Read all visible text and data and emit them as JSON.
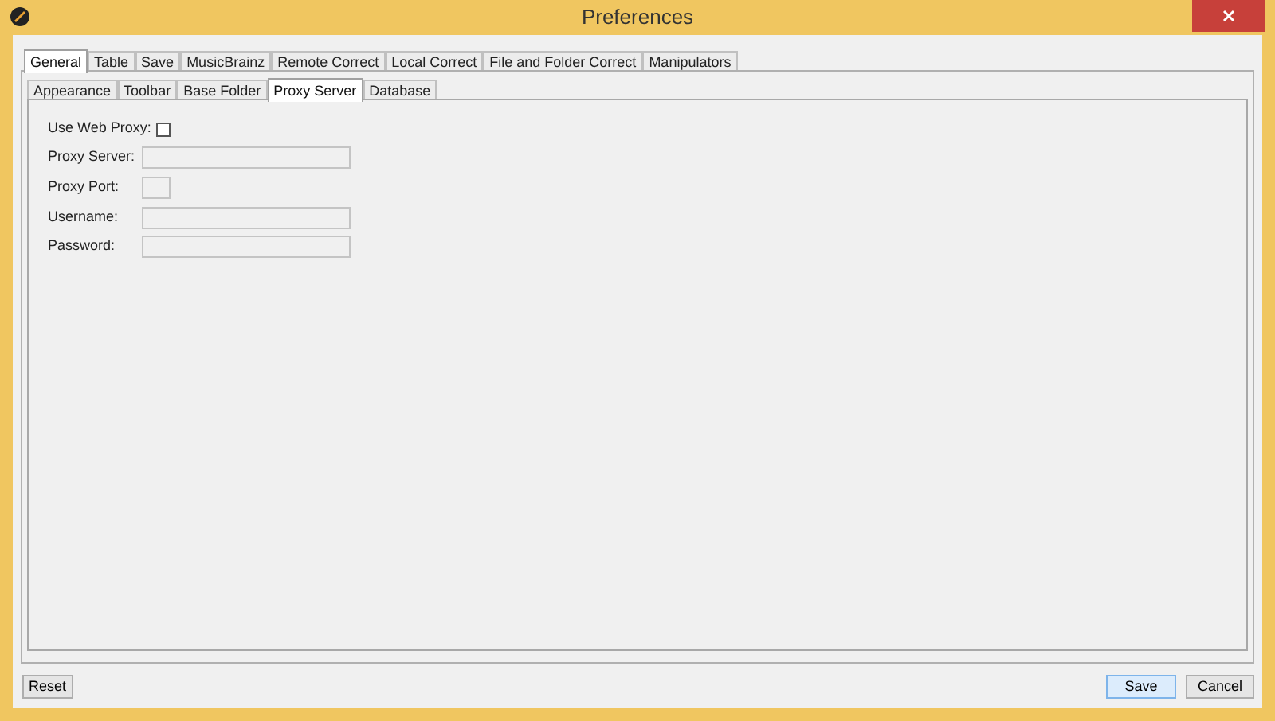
{
  "window": {
    "title": "Preferences"
  },
  "tabs": [
    {
      "label": "General",
      "selected": true
    },
    {
      "label": "Table",
      "selected": false
    },
    {
      "label": "Save",
      "selected": false
    },
    {
      "label": "MusicBrainz",
      "selected": false
    },
    {
      "label": "Remote Correct",
      "selected": false
    },
    {
      "label": "Local Correct",
      "selected": false
    },
    {
      "label": "File and Folder Correct",
      "selected": false
    },
    {
      "label": "Manipulators",
      "selected": false
    }
  ],
  "subtabs": [
    {
      "label": "Appearance",
      "selected": false
    },
    {
      "label": "Toolbar",
      "selected": false
    },
    {
      "label": "Base Folder",
      "selected": false
    },
    {
      "label": "Proxy Server",
      "selected": true
    },
    {
      "label": "Database",
      "selected": false
    }
  ],
  "form": [
    {
      "kind": "checkbox",
      "label": "Use Web Proxy:",
      "checked": false
    },
    {
      "kind": "field",
      "label": "Proxy Server:",
      "disabled": true
    },
    {
      "kind": "short_field",
      "label": "Proxy Port:",
      "disabled": true
    },
    {
      "kind": "field",
      "label": "Username:",
      "disabled": true
    },
    {
      "kind": "field",
      "label": "Password:",
      "disabled": true
    }
  ],
  "left_buttons": [
    {
      "label": "Reset",
      "default": false
    }
  ],
  "right_buttons": [
    {
      "label": "Save",
      "default": true
    },
    {
      "label": "Cancel",
      "default": false
    }
  ]
}
